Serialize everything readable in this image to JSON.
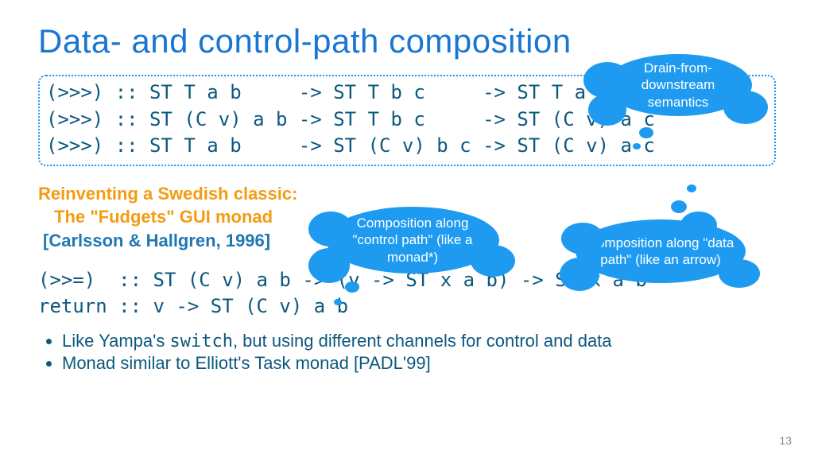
{
  "title": "Data- and control-path composition",
  "code1": {
    "l1": "(>>>) :: ST T a b     -> ST T b c     -> ST T a c",
    "l2": "(>>>) :: ST (C v) a b -> ST T b c     -> ST (C v) a c",
    "l3": "(>>>) :: ST T a b     -> ST (C v) b c -> ST (C v) a c"
  },
  "orange": {
    "l1": "Reinventing a Swedish classic:",
    "l2": "The \"Fudgets\" GUI monad",
    "l3": "[Carlsson & Hallgren, 1996]"
  },
  "code2": {
    "l1": "(>>=)  :: ST (C v) a b -> (v -> ST x a b) -> ST x a b",
    "l2": "return :: v -> ST (C v) a b"
  },
  "bullets": {
    "b1_pre": "Like Yampa's ",
    "b1_code": "switch",
    "b1_post": ", but using different channels for control and data",
    "b2": "Monad similar to Elliott's Task monad [PADL'99]"
  },
  "clouds": {
    "c1": "Drain-from-downstream semantics",
    "c2": "Composition along \"control path\" (like a monad*)",
    "c3": "Composition along \"data path\" (like an arrow)"
  },
  "page": "13"
}
